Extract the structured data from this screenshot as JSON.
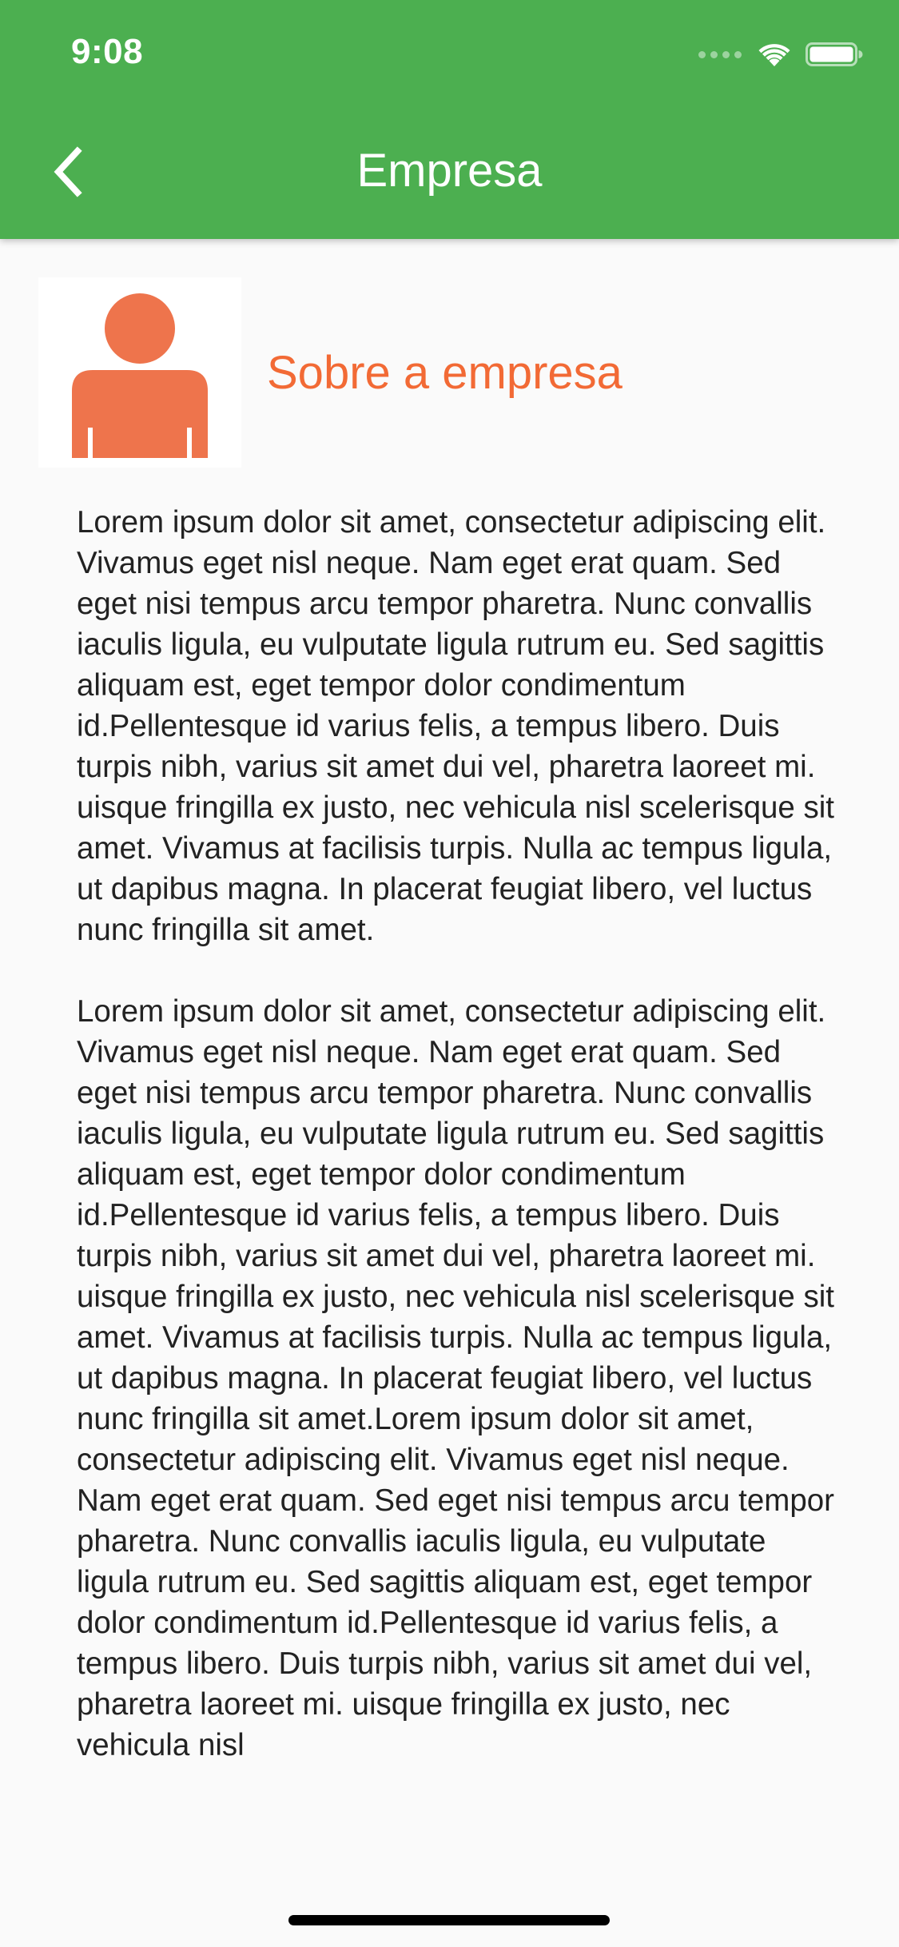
{
  "status_bar": {
    "time": "9:08"
  },
  "app_bar": {
    "title": "Empresa",
    "back_icon": "chevron-left-icon",
    "background_color": "#4caf50"
  },
  "header": {
    "avatar_icon": "person-icon",
    "title": "Sobre a empresa",
    "title_color": "#f26a35"
  },
  "content": {
    "paragraphs": [
      "Lorem ipsum dolor sit amet, consectetur adipiscing elit. Vivamus eget nisl neque. Nam eget erat quam. Sed eget nisi tempus arcu tempor pharetra. Nunc convallis iaculis ligula, eu vulputate ligula rutrum eu. Sed sagittis aliquam est, eget tempor dolor condimentum id.Pellentesque id varius felis, a tempus libero. Duis turpis nibh, varius sit amet dui vel, pharetra laoreet mi. uisque fringilla ex justo, nec vehicula nisl scelerisque sit amet. Vivamus at facilisis turpis. Nulla ac tempus ligula, ut dapibus magna. In placerat feugiat libero, vel luctus nunc fringilla sit amet.",
      "Lorem ipsum dolor sit amet, consectetur adipiscing elit. Vivamus eget nisl neque. Nam eget erat quam. Sed eget nisi tempus arcu tempor pharetra. Nunc convallis iaculis ligula, eu vulputate ligula rutrum eu. Sed sagittis aliquam est, eget tempor dolor condimentum id.Pellentesque id varius felis, a tempus libero. Duis turpis nibh, varius sit amet dui vel, pharetra laoreet mi. uisque fringilla ex justo, nec vehicula nisl scelerisque sit amet. Vivamus at facilisis turpis. Nulla ac tempus ligula, ut dapibus magna. In placerat feugiat libero, vel luctus nunc fringilla sit amet.Lorem ipsum dolor sit amet, consectetur adipiscing elit. Vivamus eget nisl neque. Nam eget erat quam. Sed eget nisi tempus arcu tempor pharetra. Nunc convallis iaculis ligula, eu vulputate ligula rutrum eu. Sed sagittis aliquam est, eget tempor dolor condimentum id.Pellentesque id varius felis, a tempus libero. Duis turpis nibh, varius sit amet dui vel, pharetra laoreet mi. uisque fringilla ex justo, nec vehicula nisl"
    ]
  }
}
